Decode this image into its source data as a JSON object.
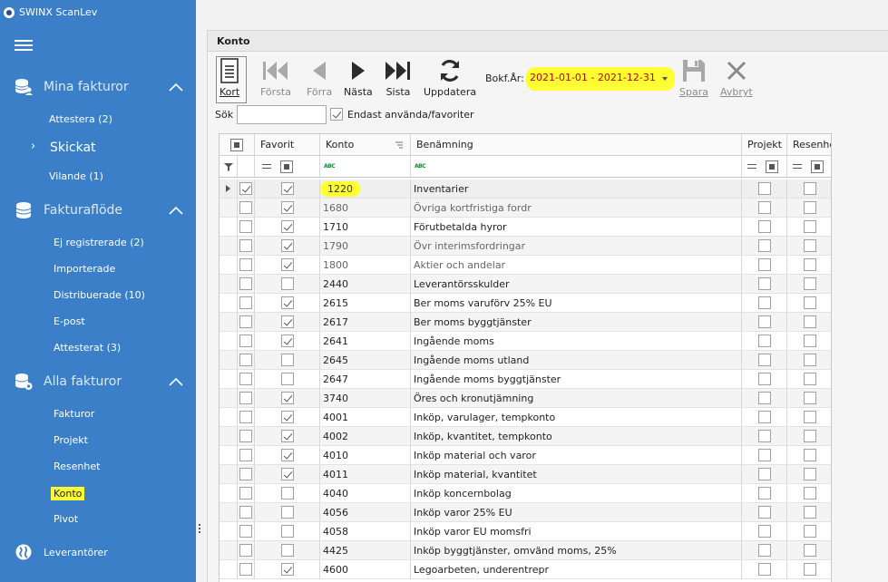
{
  "app": {
    "title": "SWINX ScanLev"
  },
  "sidebar": {
    "sections": [
      {
        "label": "Mina fakturor",
        "icon": "database-user-icon"
      },
      {
        "label": "Fakturaflöde",
        "icon": "database-icon"
      },
      {
        "label": "Alla fakturor",
        "icon": "database-gear-icon"
      },
      {
        "label": "Leverantörer",
        "icon": "globe-icon"
      }
    ],
    "mina": [
      "Attestera (2)",
      "Skickat",
      "Vilande (1)"
    ],
    "flode": [
      "Ej registrerade (2)",
      "Importerade",
      "Distribuerade (10)",
      "E-post",
      "Attesterat (3)"
    ],
    "alla": [
      "Fakturor",
      "Projekt",
      "Resenhet",
      "Konto",
      "Pivot"
    ]
  },
  "panel": {
    "title": "Konto"
  },
  "toolbar": {
    "kort": "Kort",
    "forsta": "Första",
    "forra": "Förra",
    "nasta": "Nästa",
    "sista": "Sista",
    "uppdatera": "Uppdatera",
    "bokf_label": "Bokf.År:",
    "bokf_value": "2021-01-01 - 2021-12-31",
    "spara": "Spara",
    "avbryt": "Avbryt"
  },
  "search": {
    "label": "Sök",
    "value": "",
    "endast_label": "Endast använda/favoriter",
    "endast_checked": true
  },
  "grid": {
    "columns": [
      "Favorit",
      "Konto",
      "Benämning",
      "Projekt",
      "Resenhe"
    ],
    "rows": [
      {
        "konto": "1220",
        "name": "Inventarier",
        "fav": true,
        "sel": true,
        "dim": false
      },
      {
        "konto": "1680",
        "name": "Övriga kortfristiga fordr",
        "fav": true,
        "sel": false,
        "dim": true
      },
      {
        "konto": "1710",
        "name": "Förutbetalda hyror",
        "fav": true,
        "sel": false,
        "dim": false
      },
      {
        "konto": "1790",
        "name": "Övr interimsfordringar",
        "fav": true,
        "sel": false,
        "dim": true
      },
      {
        "konto": "1800",
        "name": "Aktier och andelar",
        "fav": true,
        "sel": false,
        "dim": true
      },
      {
        "konto": "2440",
        "name": "Leverantörsskulder",
        "fav": false,
        "sel": false,
        "dim": false
      },
      {
        "konto": "2615",
        "name": "Ber moms varuförv 25% EU",
        "fav": true,
        "sel": false,
        "dim": false
      },
      {
        "konto": "2617",
        "name": "Ber moms byggtjänster",
        "fav": true,
        "sel": false,
        "dim": false
      },
      {
        "konto": "2641",
        "name": "Ingående moms",
        "fav": true,
        "sel": false,
        "dim": false
      },
      {
        "konto": "2645",
        "name": "Ingående moms utland",
        "fav": false,
        "sel": false,
        "dim": false
      },
      {
        "konto": "2647",
        "name": "Ingående moms byggtjänster",
        "fav": false,
        "sel": false,
        "dim": false
      },
      {
        "konto": "3740",
        "name": "Öres och kronutjämning",
        "fav": true,
        "sel": false,
        "dim": false
      },
      {
        "konto": "4001",
        "name": "Inköp, varulager, tempkonto",
        "fav": true,
        "sel": false,
        "dim": false
      },
      {
        "konto": "4002",
        "name": "Inköp, kvantitet, tempkonto",
        "fav": true,
        "sel": false,
        "dim": false
      },
      {
        "konto": "4010",
        "name": "Inköp material och varor",
        "fav": true,
        "sel": false,
        "dim": false
      },
      {
        "konto": "4011",
        "name": "Inköp material, kvantitet",
        "fav": true,
        "sel": false,
        "dim": false
      },
      {
        "konto": "4040",
        "name": "Inköp koncernbolag",
        "fav": false,
        "sel": false,
        "dim": false
      },
      {
        "konto": "4056",
        "name": "Inköp varor 25% EU",
        "fav": false,
        "sel": false,
        "dim": false
      },
      {
        "konto": "4058",
        "name": "Inköp varor EU momsfri",
        "fav": false,
        "sel": false,
        "dim": false
      },
      {
        "konto": "4425",
        "name": "Inköp byggtjänster, omvänd moms, 25%",
        "fav": false,
        "sel": false,
        "dim": false
      },
      {
        "konto": "4600",
        "name": "Legoarbeten, underentrepr",
        "fav": true,
        "sel": false,
        "dim": false
      }
    ]
  },
  "colors": {
    "sidebar": "#3a7fc8",
    "highlight": "#ffff33",
    "date_text": "#c00000"
  }
}
